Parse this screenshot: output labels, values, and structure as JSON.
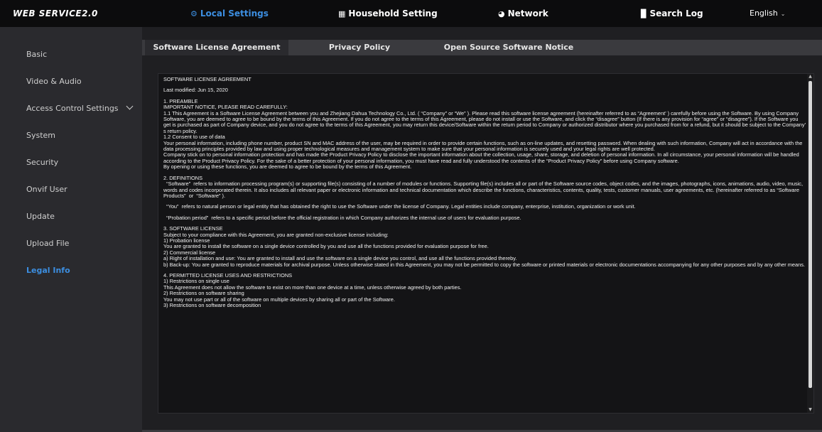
{
  "app": {
    "brand": "WEB SERVICE2.0"
  },
  "topnav": {
    "local_settings": "Local Settings",
    "household_setting": "Household Setting",
    "network": "Network",
    "search_log": "Search Log",
    "language": "English"
  },
  "sidebar": {
    "items": [
      {
        "label": "Basic"
      },
      {
        "label": "Video & Audio"
      },
      {
        "label": "Access Control Settings"
      },
      {
        "label": "System"
      },
      {
        "label": "Security"
      },
      {
        "label": "Onvif User"
      },
      {
        "label": "Update"
      },
      {
        "label": "Upload File"
      },
      {
        "label": "Legal Info"
      }
    ],
    "active": "Legal Info"
  },
  "tabs": {
    "license": "Software License Agreement",
    "privacy": "Privacy Policy",
    "opensource": "Open Source Software Notice"
  },
  "document": {
    "paragraphs": [
      "SOFTWARE LICENSE AGREEMENT",
      "Last modified: Jun 15, 2020",
      "1. PREAMBLE\nIMPORTANT NOTICE, PLEASE READ CAREFULLY:\n1.1 This Agreement is a Software License Agreement between you and Zhejiang Dahua Technology Co., Ltd. ( “Company” or “We” ). Please read this software license agreement (hereinafter referred to as “Agreement’ ) carefully before using the Software. By using Company Software, you are deemed to agree to be bound by the terms of this Agreement. If you do not agree to the terms of this Agreement, please do not install or use the Software, and click the “disagree” button (If there is any provision for “agree” or “disagree”). If the Software you get is purchased as part of Company device, and you do not agree to the terms of this Agreement, you may return this device/Software within the return period to Company or authorized distributor where you purchased from for a refund, but it should be subject to the Company’ s return policy.\n1.2 Consent to use of data\nYour personal information, including phone number, product SN and MAC address of the user, may be required in order to provide certain functions, such as on-line updates, and resetting password. When dealing with such information, Company will act in accordance with the data processing principles provided by law and using proper technological measures and management system to make sure that your personal information is securely used and your legal rights are well protected.\nCompany stick on to personal information protection and has made the Product Privacy Policy to disclose the important information about the collection, usage, share, storage, and deletion of personal information. In all circumstance, your personal information will be handled according to the Product Privacy Policy. For the sake of a better protection of your personal information, you must have read and fully understood the contents of the “Product Privacy Policy” before using Company software.\nBy opening or using these functions, you are deemed to agree to be bound by the terms of this Agreement.",
      "2. DEFINITIONS\n  “Software”  refers to information processing program(s) or supporting file(s) consisting of a number of modules or functions. Supporting file(s) includes all or part of the Software source codes, object codes, and the images, photographs, icons, animations, audio, video, music, words and codes incorporated therein. It also includes all relevant paper or electronic information and technical documentation which describe the functions, characteristics, contents, quality, tests, customer manuals, user agreements, etc. (hereinafter referred to as “Software Products”  or  “Software” ).",
      "  “You”  refers to natural person or legal entity that has obtained the right to use the Software under the license of Company. Legal entities include company, enterprise, institution, organization or work unit.",
      "  “Probation period”  refers to a specific period before the official registration in which Company authorizes the internal use of users for evaluation purpose.",
      "3. SOFTWARE LICENSE\nSubject to your compliance with this Agreement, you are granted non-exclusive license including:\n1) Probation license\nYou are granted to install the software on a single device controlled by you and use all the functions provided for evaluation purpose for free.\n2) Commercial license\na) Right of installation and use: You are granted to install and use the software on a single device you control, and use all the functions provided thereby.\nb) Back-up: You are granted to reproduce materials for archival purpose. Unless otherwise stated in this Agreement, you may not be permitted to copy the software or printed materials or electronic documentations accompanying for any other purposes and by any other means.",
      "4. PERMITTED LICENSE USES AND RESTRICTIONS\n1) Restrictions on single use\nThis Agreement does not allow the software to exist on more than one device at a time, unless otherwise agreed by both parties.\n2) Restrictions on software sharing\nYou may not use part or all of the software on multiple devices by sharing all or part of the Software.\n3) Restrictions on software decomposition"
    ]
  },
  "colors": {
    "accent": "#3c8ee0",
    "topbar": "#0c0c0d",
    "sidebar": "#2a2a2e",
    "content_bg": "#1f1f22"
  }
}
